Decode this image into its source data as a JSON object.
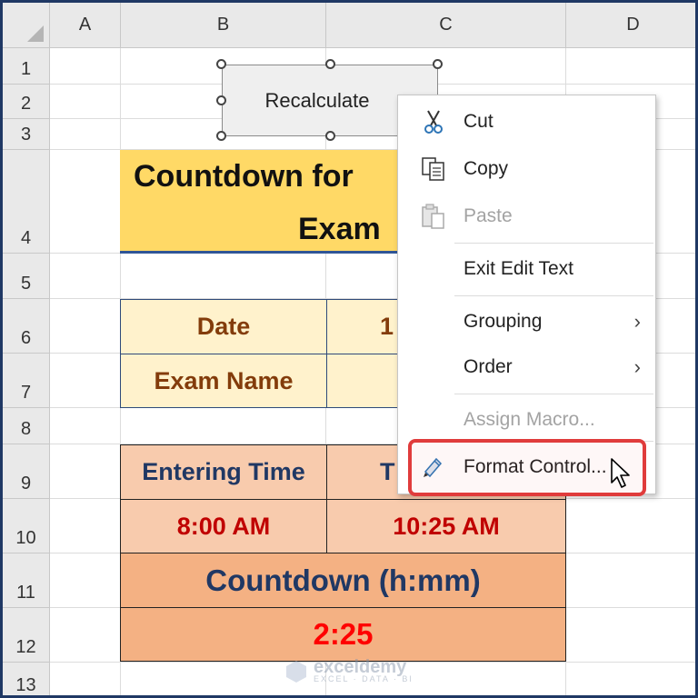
{
  "columns": [
    "A",
    "B",
    "C",
    "D"
  ],
  "rows": [
    "1",
    "2",
    "3",
    "4",
    "5",
    "6",
    "7",
    "8",
    "9",
    "10",
    "11",
    "12",
    "13"
  ],
  "button": {
    "label": "Recalculate"
  },
  "title": {
    "line1": "Countdown for",
    "line2": "Exam"
  },
  "table1": {
    "date_label": "Date",
    "date_value_partial": "1",
    "exam_name_label": "Exam Name"
  },
  "table2": {
    "entering_time_label": "Entering Time",
    "t_label_partial": "T",
    "entering_time_value": "8:00 AM",
    "t_value": "10:25 AM",
    "countdown_label": "Countdown (h:mm)",
    "countdown_value": "2:25"
  },
  "context_menu": {
    "items": [
      {
        "label": "Cut",
        "icon": "scissors-icon",
        "enabled": true
      },
      {
        "label": "Copy",
        "icon": "copy-icon",
        "enabled": true
      },
      {
        "label": "Paste",
        "icon": "paste-icon",
        "enabled": false
      },
      {
        "label": "Exit Edit Text",
        "icon": "",
        "enabled": true
      },
      {
        "label": "Grouping",
        "icon": "",
        "enabled": true,
        "submenu": true
      },
      {
        "label": "Order",
        "icon": "",
        "enabled": true,
        "submenu": true
      },
      {
        "label": "Assign Macro...",
        "icon": "",
        "enabled": false
      },
      {
        "label": "Format Control...",
        "icon": "format-control-icon",
        "enabled": true,
        "highlighted": true
      }
    ]
  },
  "watermark": {
    "name": "exceldemy",
    "tagline": "EXCEL · DATA · BI"
  },
  "colors": {
    "title_fill": "#ffd966",
    "table1_fill": "#fff2cc",
    "table1_text": "#833c0b",
    "table2_fill": "#f8cbad",
    "table2_dark_fill": "#f4b183",
    "dark_blue_text": "#203864",
    "red_text": "#c00000",
    "bright_red_text": "#ff0000",
    "highlight_border": "#e03c3c"
  }
}
